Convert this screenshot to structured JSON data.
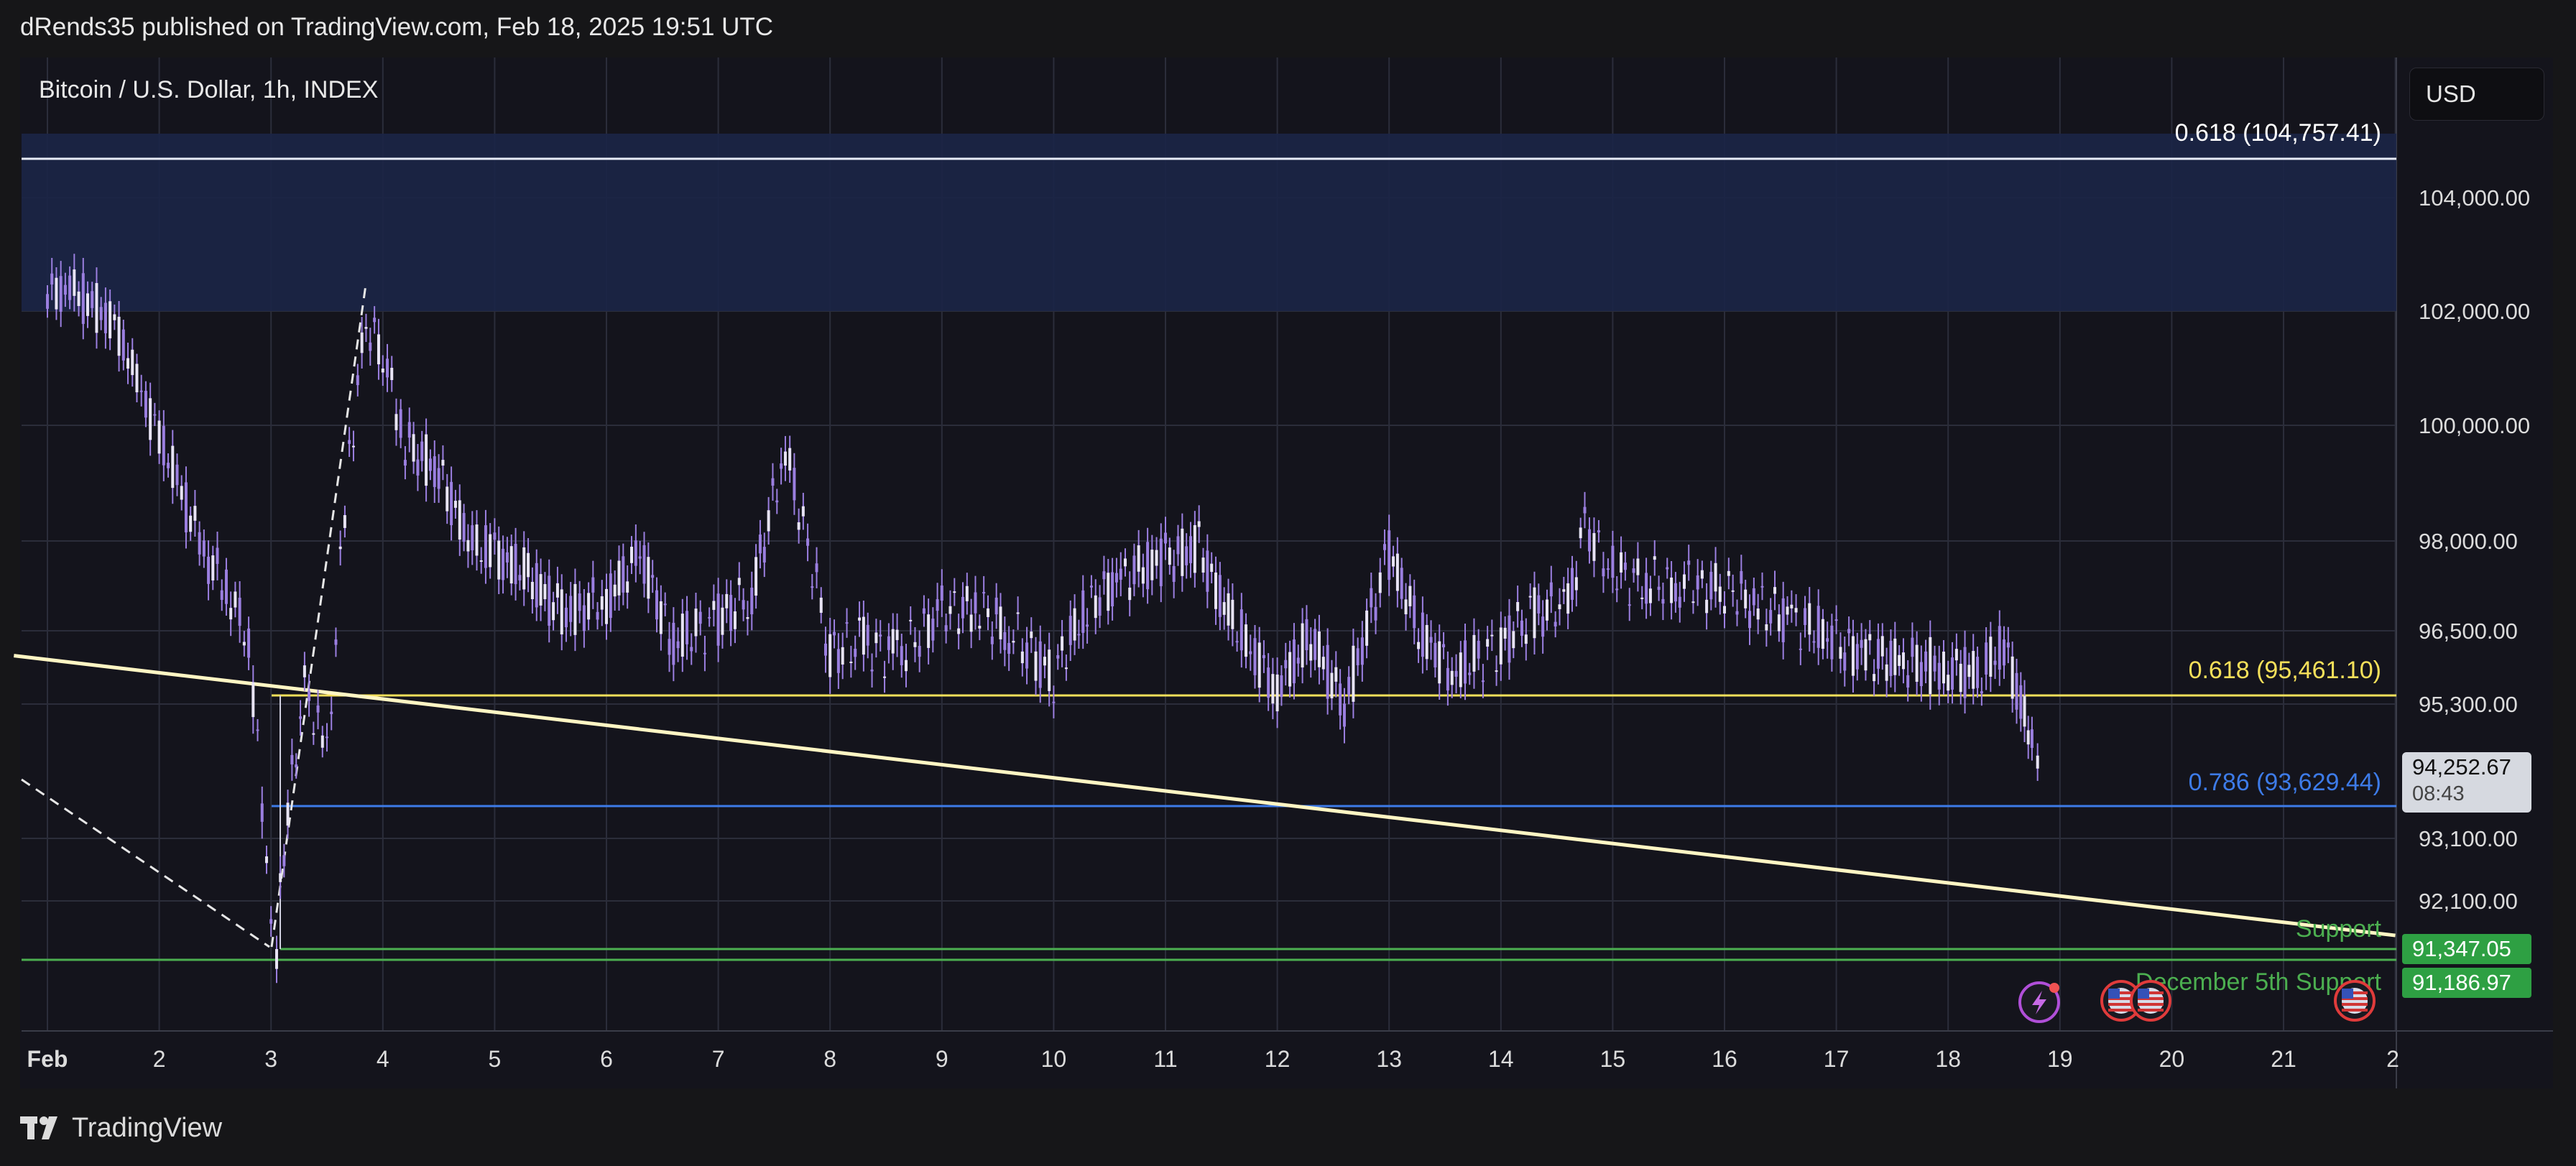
{
  "header": {
    "publisher_line": "dRends35 published on TradingView.com, Feb 18, 2025 19:51 UTC"
  },
  "chart": {
    "symbol_line": "Bitcoin / U.S. Dollar, 1h, INDEX",
    "currency_button": "USD",
    "current_price": "94,252.67",
    "countdown": "08:43",
    "support_tag_1": "91,347.05",
    "support_tag_2": "91,186.97",
    "fib_top_label": "0.618 (104,757.41)",
    "fib_mid_label": "0.618 (95,461.10)",
    "fib_low_label": "0.786 (93,629.44)",
    "support_label": "Support",
    "dec_support_label": "December 5th Support",
    "colors": {
      "background": "#14141c",
      "candle": "#9b7fe0",
      "fib_mid": "#f5e05a",
      "fib_low": "#3d7be8",
      "support": "#4caf50",
      "trendline": "#fff6c4",
      "resistance_band": "#1b2547"
    }
  },
  "footer": {
    "brand": "TradingView"
  },
  "chart_data": {
    "type": "line",
    "title": "Bitcoin / U.S. Dollar, 1h, INDEX",
    "x_tick_labels": [
      "Feb",
      "2",
      "3",
      "4",
      "5",
      "6",
      "7",
      "8",
      "9",
      "10",
      "11",
      "12",
      "13",
      "14",
      "15",
      "16",
      "17",
      "18",
      "19",
      "20",
      "21",
      "2"
    ],
    "y_tick_labels": [
      "104,000.00",
      "102,000.00",
      "100,000.00",
      "98,000.00",
      "96,500.00",
      "95,300.00",
      "93,100.00",
      "92,100.00"
    ],
    "y_ticks": [
      104000,
      102000,
      100000,
      98000,
      96500,
      95300,
      93100,
      92100
    ],
    "series": [
      {
        "x": [
          1.0,
          1.2,
          1.4,
          1.6,
          1.8,
          2.0,
          2.2,
          2.4,
          2.6,
          2.8,
          3.0,
          3.05,
          3.15,
          3.3,
          3.5,
          3.7,
          3.85,
          4.0,
          4.2,
          4.5,
          4.8,
          5.0,
          5.3,
          5.6,
          6.0,
          6.3,
          6.6,
          7.0,
          7.3,
          7.6,
          8.0,
          8.3,
          8.6,
          9.0,
          9.3,
          9.6,
          10.0,
          10.3,
          10.6,
          11.0,
          11.3,
          11.6,
          12.0,
          12.3,
          12.6,
          13.0,
          13.3,
          13.6,
          14.0,
          14.3,
          14.6,
          14.75,
          15.0,
          15.3,
          15.6,
          16.0,
          16.3,
          16.6,
          17.0,
          17.3,
          17.6,
          18.0,
          18.3,
          18.5,
          18.65,
          18.75,
          18.8
        ],
        "y": [
          102300,
          102400,
          102100,
          101800,
          100800,
          99800,
          98800,
          97800,
          97200,
          96400,
          92000,
          91400,
          93500,
          95600,
          94400,
          99500,
          101800,
          101300,
          99700,
          99200,
          97900,
          97800,
          97400,
          96800,
          97000,
          97800,
          96300,
          96700,
          97100,
          99600,
          96200,
          96300,
          96100,
          96800,
          96900,
          96500,
          95800,
          96900,
          97400,
          97700,
          97900,
          96600,
          95600,
          96400,
          95300,
          97800,
          96400,
          95800,
          96300,
          96800,
          96900,
          98300,
          97500,
          97300,
          97300,
          97200,
          96900,
          96700,
          96300,
          96100,
          96000,
          95900,
          95800,
          96300,
          95300,
          94600,
          94252.67
        ]
      }
    ],
    "horizontal_levels": [
      {
        "label": "0.618 (104,757.41)",
        "y": 104757.41
      },
      {
        "label": "0.618 (95,461.10)",
        "y": 95461.1
      },
      {
        "label": "0.786 (93,629.44)",
        "y": 93629.44
      },
      {
        "label": "Support",
        "y": 91347.05
      },
      {
        "label": "December 5th Support",
        "y": 91186.97
      }
    ],
    "trendline": {
      "x": [
        0.7,
        22.0
      ],
      "y": [
        96100,
        91560
      ]
    },
    "resistance_zone": [
      102000,
      105300
    ],
    "ylim": [
      90500,
      106200
    ],
    "grid": true
  }
}
